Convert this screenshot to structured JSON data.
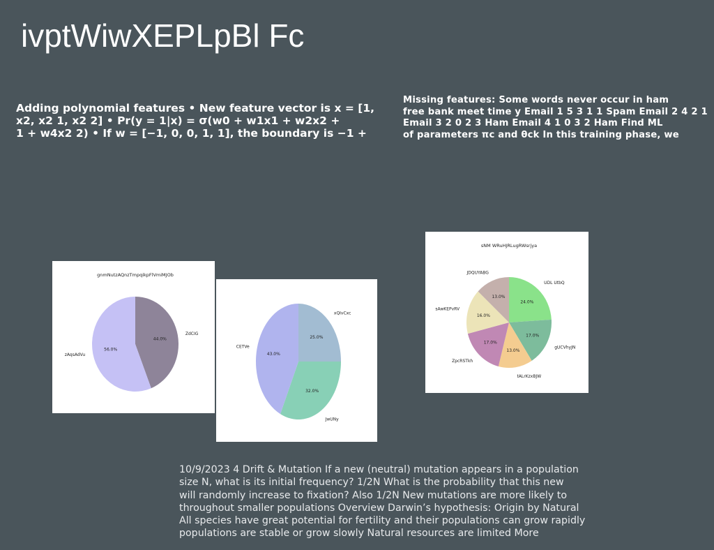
{
  "slide": {
    "title": "ivptWiwXEPLpBl Fc"
  },
  "left_text": {
    "lines": [
      "Adding polynomial features • New feature vector is x = [1,",
      "x2, x2 1, x2 2] • Pr(y = 1|x) = σ(w0 + w1x1 + w2x2 +",
      "1 + w4x2 2) • If w = [−1, 0, 0, 1, 1], the boundary is −1 +"
    ]
  },
  "right_text": {
    "lines": [
      "Missing features: Some words never occur in ham",
      "free bank meet time y Email 1 5 3 1 1 Spam Email 2 4 2 1 1",
      "Email 3 2 0 2 3 Ham Email 4 1 0 3 2 Ham Find ML",
      "of parameters πc and θck In this training phase, we"
    ]
  },
  "footer_text": {
    "lines": [
      "10/9/2023 4 Drift & Mutation  If a new (neutral) mutation appears in a population",
      "size N, what is its initial frequency? 1/2N  What is the probability that this new",
      "will randomly increase to fixation? Also 1/2N  New mutations are more likely to",
      "throughout smaller populations Overview Darwin’s hypothesis: Origin by Natural",
      "All species have great potential for fertility and their populations can grow rapidly",
      "populations are stable or grow slowly Natural resources are limited More"
    ]
  },
  "chart_data": [
    {
      "type": "pie",
      "title": "gnmNutzAQnzTmpqikpFlVmiMJOb",
      "slices": [
        {
          "label": "ZdCIG",
          "value": 44.0,
          "pct_label": "44.0%",
          "color": "#8e8499"
        },
        {
          "label": "zAqsAdVu",
          "value": 56.0,
          "pct_label": "56.0%",
          "color": "#c5c1f5"
        }
      ]
    },
    {
      "type": "pie",
      "title": "",
      "slices": [
        {
          "label": "xQIvCxc",
          "value": 25.0,
          "pct_label": "25.0%",
          "color": "#a2bcd2"
        },
        {
          "label": "JwUNy",
          "value": 32.0,
          "pct_label": "32.0%",
          "color": "#88d0b6"
        },
        {
          "label": "CETVe",
          "value": 43.0,
          "pct_label": "43.0%",
          "color": "#b0b4ee"
        }
      ]
    },
    {
      "type": "pie",
      "title": "sNM WRuHJRLugRWsrjya",
      "slices": [
        {
          "label": "UDL UtbQ",
          "value": 24.0,
          "pct_label": "24.0%",
          "color": "#8ae28a"
        },
        {
          "label": "gUCVhyJN",
          "value": 17.0,
          "pct_label": "17.0%",
          "color": "#7dbc9c"
        },
        {
          "label": "tALrKzxBJW",
          "value": 13.0,
          "pct_label": "13.0%",
          "color": "#f4cc90"
        },
        {
          "label": "ZpcRSTkh",
          "value": 17.0,
          "pct_label": "17.0%",
          "color": "#c088b4"
        },
        {
          "label": "sAwKEPvRV",
          "value": 16.0,
          "pct_label": "16.0%",
          "color": "#ece4b8"
        },
        {
          "label": "JDQUYABG",
          "value": 13.0,
          "pct_label": "13.0%",
          "color": "#c4b0ac"
        }
      ]
    }
  ]
}
